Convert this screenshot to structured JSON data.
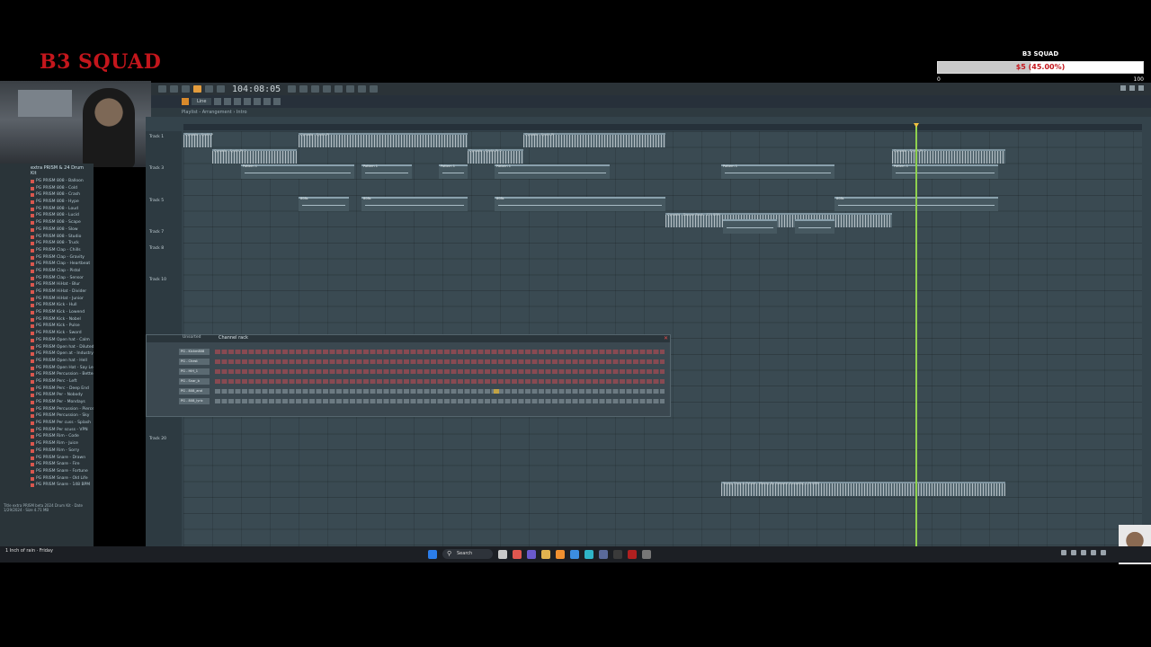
{
  "overlay": {
    "brand": "B3 SQUAD",
    "goal_title": "B3 SQUAD",
    "goal_amount": "$5 (45.00%)",
    "goal_progress": 0.45,
    "goal_start": "0",
    "goal_end": "100"
  },
  "fl": {
    "time": "104:08:05",
    "mode": "Line",
    "crumb": "Playlist - Arrangement › Intro",
    "rack_title": "Channel rack",
    "rack_selector": "Unsorted"
  },
  "browser": {
    "folder": "extra PRISM & 24 Drum Kit",
    "items": [
      "PG PRISM 808 - Balloon",
      "PG PRISM 808 - Cold",
      "PG PRISM 808 - Crash",
      "PG PRISM 808 - Hype",
      "PG PRISM 808 - Loud",
      "PG PRISM 808 - Lucid",
      "PG PRISM 808 - Scape",
      "PG PRISM 808 - Slow",
      "PG PRISM 808 - Studio",
      "PG PRISM 808 - Truck",
      "PG PRISM Clap - Chills",
      "PG PRISM Clap - Gravity",
      "PG PRISM Clap - Heartbeat",
      "PG PRISM Clap - Pistol",
      "PG PRISM Clap - Sensor",
      "PG PRISM HiHat - Blur",
      "PG PRISM HiHat - Divider",
      "PG PRISM HiHat - Junior",
      "PG PRISM Kick - Hull",
      "PG PRISM Kick - Lowend",
      "PG PRISM Kick - Nobel",
      "PG PRISM Kick - Pulse",
      "PG PRISM Kick - Sword",
      "PG PRISM Open hat - Calm",
      "PG PRISM Open hat - Diluted",
      "PG PRISM Open at - Industry",
      "PG PRISM Open hat - Hell",
      "PG PRISM Open Hat - Say Less",
      "PG PRISM Percussion - Better",
      "PG PRISM Perc - Left",
      "PG PRISM Perc - Deep End",
      "PG PRISM Per - Nobody",
      "PG PRISM Per - Mondays",
      "PG PRISM Percussion - Pierce",
      "PG PRISM Percussion - Sky",
      "PG PRISM Per cuss - Splash",
      "PG PRISM Per scuss - VPN",
      "PG PRISM Rim - Code",
      "PG PRISM Rim - Juice",
      "PG PRISM Rim - Sorry",
      "PG PRISM Snare - Drawn",
      "PG PRISM Snare - Fire",
      "PG PRISM Snare - Fortune",
      "PG PRISM Snare - Old Life",
      "PG PRISM Snare - 148 BPM"
    ],
    "info": "Title extra PRISM beta 2024 Drum Kit · Date 1/29/2024 · Size 4.71 MB"
  },
  "tracks": [
    {
      "label": "Track 1",
      "offset": 0
    },
    {
      "label": "Track 3",
      "offset": 2
    },
    {
      "label": "Track 5",
      "offset": 4
    },
    {
      "label": "Track 7",
      "offset": 6
    },
    {
      "label": "Track 8",
      "offset": 7
    },
    {
      "label": "Track 10",
      "offset": 9
    },
    {
      "label": "Track 20",
      "offset": 19
    }
  ],
  "clips": [
    {
      "label": "Cynoeia - Synth Pt",
      "track": 0
    },
    {
      "label": "Cynoeia - Synth Pt 2",
      "track": 1
    },
    {
      "label": "Pattern 1",
      "track": 2
    },
    {
      "label": "808s",
      "track": 4
    },
    {
      "label": "Cynoeia - Zapper Back - 123 BPM",
      "track": 5
    },
    {
      "label": "Young Thug & Future - Money By Blessed (Acapella) 129 BPM",
      "track": 7
    }
  ],
  "rack_rows": [
    "PG - Kickm808",
    "PG - Chest",
    "PG - HiH_1",
    "PG - Snar_b",
    "PG - 808_and",
    "PG - 808_lyric"
  ],
  "taskbar": {
    "left": "1 Inch of rain · Friday",
    "search": "Search"
  },
  "colors": {
    "brand": "#c4161c",
    "playhead": "#8fd14f",
    "rack_active_step": "#a24a52",
    "accent": "#e39c3d"
  }
}
